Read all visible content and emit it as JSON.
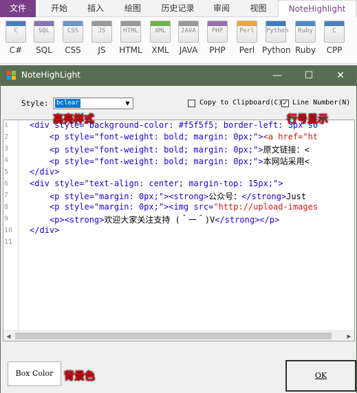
{
  "ribbon": {
    "tabs": [
      "文件",
      "开始",
      "插入",
      "绘图",
      "历史记录",
      "审阅",
      "视图",
      "NoteHighlight"
    ],
    "languages": [
      {
        "label": "C#",
        "mark": "C",
        "color": "#4c7dbb"
      },
      {
        "label": "SQL",
        "mark": "SQL",
        "color": "#8a73b5"
      },
      {
        "label": "CSS",
        "mark": "CSS",
        "color": "#6a95c9"
      },
      {
        "label": "JS",
        "mark": "JS",
        "color": "#999999"
      },
      {
        "label": "HTML",
        "mark": "HTML",
        "color": "#999999"
      },
      {
        "label": "XML",
        "mark": "XML",
        "color": "#6db34a"
      },
      {
        "label": "JAVA",
        "mark": "JAVA",
        "color": "#999999"
      },
      {
        "label": "PHP",
        "mark": "PHP",
        "color": "#9a6fb0"
      },
      {
        "label": "Perl",
        "mark": "Perl",
        "color": "#e8a83b"
      },
      {
        "label": "Python",
        "mark": "Python",
        "color": "#3f7bbf"
      },
      {
        "label": "Ruby",
        "mark": "Ruby",
        "color": "#4e89c7"
      },
      {
        "label": "CPP",
        "mark": "C",
        "color": "#4c7dbb"
      }
    ]
  },
  "dialog": {
    "title": "NoteHighLight",
    "minimize": "—",
    "maximize": "☐",
    "close": "✕",
    "style_label": "Style:",
    "style_value": "bclear",
    "copy_clipboard_label": "Copy to Clipboard(C)",
    "copy_clipboard_checked": "",
    "line_number_label": "Line Number(N)",
    "line_number_checked": "✓",
    "box_color_label": "Box Color",
    "ok_label": "OK"
  },
  "annotations": {
    "highlight_style": "高亮样式",
    "line_number_display": "行号显示",
    "background_color": "背景色"
  },
  "code": {
    "line_numbers": [
      "1",
      "2",
      "3",
      "4",
      "5",
      "6",
      "7",
      "8",
      "9",
      "10",
      "11"
    ],
    "lines": [
      [
        [
          "<div ",
          "#1c00cf"
        ],
        [
          "style=",
          "#1c00cf"
        ],
        [
          "\"background-color: #f5f5f5; border-left: 3px so",
          "#1c00cf"
        ]
      ],
      [
        [
          "    <p ",
          "#1c00cf"
        ],
        [
          "style=",
          "#1c00cf"
        ],
        [
          "\"font-weight: bold; margin: 0px;\"",
          "#1c00cf"
        ],
        [
          ">",
          "#1c00cf"
        ],
        [
          "<a href=\"ht",
          "#c41a16"
        ]
      ],
      [
        [
          "    <p ",
          "#1c00cf"
        ],
        [
          "style=",
          "#1c00cf"
        ],
        [
          "\"font-weight: bold; margin: 0px;\"",
          "#1c00cf"
        ],
        [
          ">",
          "#1c00cf"
        ],
        [
          "原文链接：<",
          "#000000"
        ]
      ],
      [
        [
          "    <p ",
          "#1c00cf"
        ],
        [
          "style=",
          "#1c00cf"
        ],
        [
          "\"font-weight: bold; margin: 0px;\"",
          "#1c00cf"
        ],
        [
          ">",
          "#1c00cf"
        ],
        [
          "本网站采用<",
          "#000000"
        ]
      ],
      [
        [
          "</div>",
          "#1c00cf"
        ]
      ],
      [
        [
          "<div ",
          "#1c00cf"
        ],
        [
          "style=",
          "#1c00cf"
        ],
        [
          "\"text-align: center; margin-top: 15px;\"",
          "#1c00cf"
        ],
        [
          ">",
          "#1c00cf"
        ]
      ],
      [
        [
          "    <p ",
          "#1c00cf"
        ],
        [
          "style=",
          "#1c00cf"
        ],
        [
          "\"margin: 0px;\"",
          "#1c00cf"
        ],
        [
          "><strong>",
          "#1c00cf"
        ],
        [
          "公众号：",
          "#000000"
        ],
        [
          "</strong>",
          "#1c00cf"
        ],
        [
          "Just",
          "#000000"
        ]
      ],
      [
        [
          "    <p ",
          "#1c00cf"
        ],
        [
          "style=",
          "#1c00cf"
        ],
        [
          "\"margin: 0px;\"",
          "#1c00cf"
        ],
        [
          "><img src=",
          "#1c00cf"
        ],
        [
          "\"http://upload-images",
          "#c41a16"
        ]
      ],
      [
        [
          "    <p><strong>",
          "#1c00cf"
        ],
        [
          "欢迎大家关注支持 (＾一＾)V",
          "#000000"
        ],
        [
          "</strong></p>",
          "#1c00cf"
        ]
      ],
      [
        [
          "</div>",
          "#1c00cf"
        ]
      ],
      [
        [
          "",
          "#000000"
        ]
      ]
    ]
  }
}
